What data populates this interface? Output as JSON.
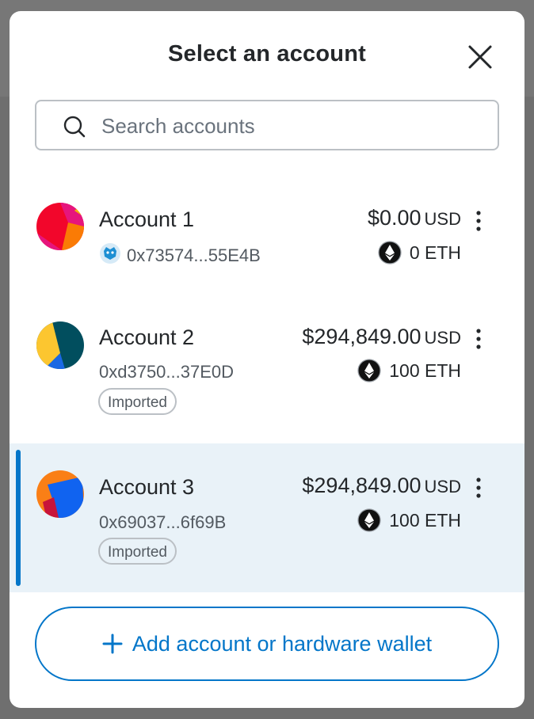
{
  "modal": {
    "title": "Select an account",
    "close_icon": "close-icon"
  },
  "search": {
    "placeholder": "Search accounts",
    "value": "",
    "icon": "search-icon"
  },
  "accounts": [
    {
      "name": "Account 1",
      "address": "0x73574...55E4B",
      "fiat_value": "$0.00",
      "fiat_currency": "USD",
      "eth_value": "0 ETH",
      "badge": "",
      "has_snap_icon": true,
      "selected": false,
      "avatar_colors": [
        "#f2062b",
        "#f4b400",
        "#e6157d",
        "#fa7b05"
      ]
    },
    {
      "name": "Account 2",
      "address": "0xd3750...37E0D",
      "fiat_value": "$294,849.00",
      "fiat_currency": "USD",
      "eth_value": "100 ETH",
      "badge": "Imported",
      "has_snap_icon": false,
      "selected": false,
      "avatar_colors": [
        "#014e5e",
        "#fcc630",
        "#1a68e3",
        "#f25b12"
      ]
    },
    {
      "name": "Account 3",
      "address": "0x69037...6f69B",
      "fiat_value": "$294,849.00",
      "fiat_currency": "USD",
      "eth_value": "100 ETH",
      "badge": "Imported",
      "has_snap_icon": false,
      "selected": true,
      "avatar_colors": [
        "#fa7f16",
        "#1063f0",
        "#c8143a",
        "#f2a017"
      ]
    }
  ],
  "footer": {
    "add_label": "Add account or hardware wallet",
    "icon": "plus-icon"
  },
  "colors": {
    "primary": "#0376c9",
    "text": "#24272a",
    "muted": "#535a61",
    "selected_bg": "#e9f2f8",
    "border": "#bbc0c5"
  }
}
